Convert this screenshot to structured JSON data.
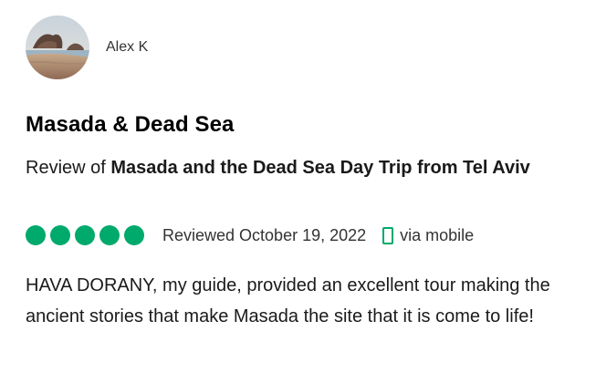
{
  "reviewer": {
    "name": "Alex K"
  },
  "review": {
    "title": "Masada & Dead Sea",
    "review_of_prefix": "Review of ",
    "tour_name": "Masada and the Dead Sea Day Trip from Tel Aviv",
    "rating": 5,
    "rating_max": 5,
    "reviewed_date": "Reviewed October 19, 2022",
    "via": "via mobile",
    "text": "HAVA DORANY, my guide, provided an excellent tour making the ancient stories that make Masada the site that it is come to life!"
  },
  "colors": {
    "rating_green": "#00aa6c",
    "text_dark": "#1a1a1a"
  },
  "icons": {
    "device": "mobile-phone-icon"
  }
}
